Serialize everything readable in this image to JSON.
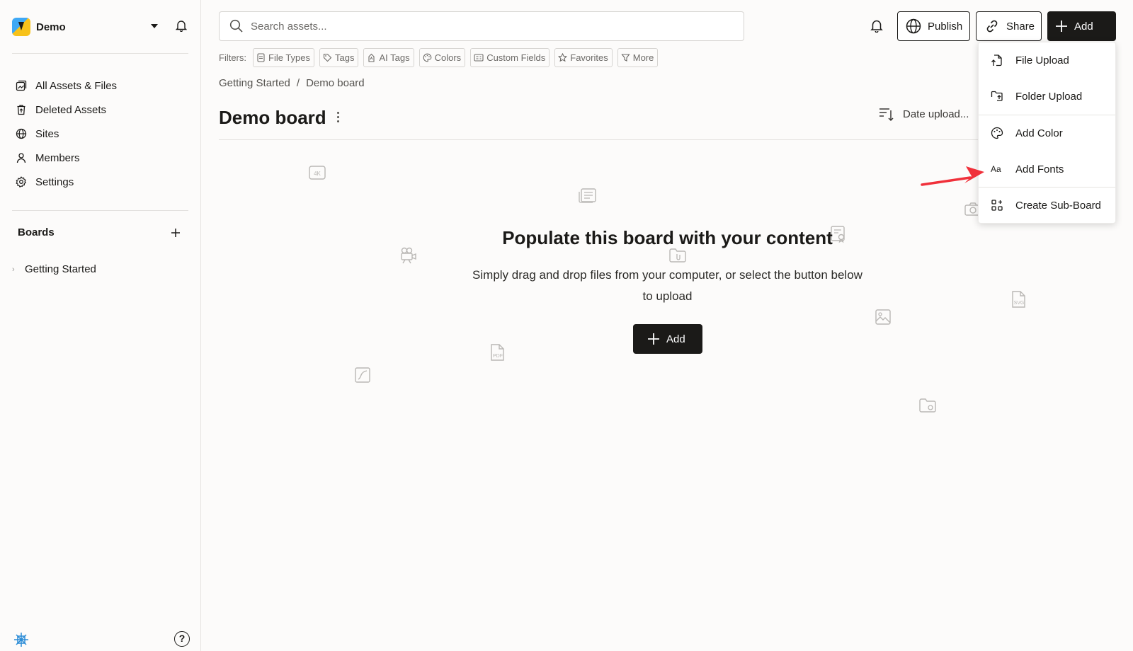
{
  "workspace": {
    "name": "Demo"
  },
  "sidebar": {
    "nav": [
      {
        "label": "All Assets & Files",
        "icon": "assets-icon"
      },
      {
        "label": "Deleted Assets",
        "icon": "trash-icon"
      },
      {
        "label": "Sites",
        "icon": "globe-icon"
      },
      {
        "label": "Members",
        "icon": "person-icon"
      },
      {
        "label": "Settings",
        "icon": "gear-icon"
      }
    ],
    "boards_title": "Boards",
    "tree": [
      {
        "label": "Getting Started",
        "icon": "chevron-right-icon"
      }
    ]
  },
  "search": {
    "placeholder": "Search assets..."
  },
  "toolbar": {
    "publish_label": "Publish",
    "share_label": "Share",
    "add_label": "Add"
  },
  "filters": {
    "label": "Filters:",
    "chips": [
      "File Types",
      "Tags",
      "AI Tags",
      "Colors",
      "Custom Fields",
      "Favorites",
      "More"
    ]
  },
  "breadcrumb": {
    "parent": "Getting Started",
    "separator": "/",
    "current": "Demo board"
  },
  "page": {
    "title": "Demo board",
    "sort_label": "Date upload..."
  },
  "empty_state": {
    "title": "Populate this board with your content",
    "description": "Simply drag and drop files from your computer, or select the button below to upload",
    "button_label": "Add"
  },
  "add_menu": {
    "items": [
      {
        "label": "File Upload",
        "icon": "file-upload-icon"
      },
      {
        "label": "Folder Upload",
        "icon": "folder-upload-icon"
      },
      {
        "label": "Add Color",
        "icon": "palette-icon"
      },
      {
        "label": "Add Fonts",
        "icon": "font-icon"
      },
      {
        "label": "Create Sub-Board",
        "icon": "sub-board-icon"
      }
    ]
  },
  "colors": {
    "accent": "#1b1a18",
    "annotation_arrow": "#f0303a",
    "background": "#fcfbfa"
  }
}
